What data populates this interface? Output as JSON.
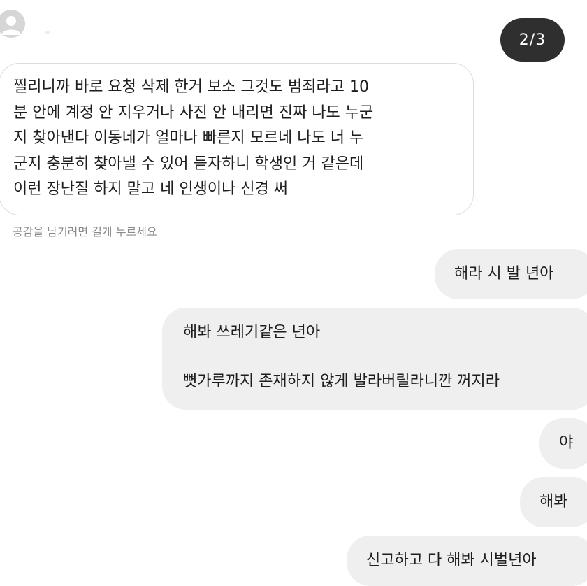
{
  "pager": {
    "counter": "2/3"
  },
  "incoming": {
    "lines": [
      "찔리니까 바로 요청 삭제 한거 보소 그것도 범죄라고 10",
      "분 안에 계정 안 지우거나 사진 안 내리면 진짜 나도 누군",
      "지 찾아낸다 이동네가 얼마나 빠른지 모르네 나도 너 누",
      "군지 충분히 찾아낼 수 있어 듣자하니 학생인 거 같은데",
      "이런 장난질 하지 말고 네 인생이나 신경 써"
    ],
    "hint": "공감을 남기려면 길게 누르세요"
  },
  "outgoing": [
    {
      "text": "해라 시 발 년아"
    },
    {
      "line1": "해봐 쓰레기같은 년아",
      "line2": "뼛가루까지 존재하지 않게 발라버릴라니깐 꺼지라"
    },
    {
      "text": "야"
    },
    {
      "text": "해봐"
    },
    {
      "text": "신고하고 다 해봐 시벌년아"
    }
  ],
  "colors": {
    "background": "#ffffff",
    "outgoing_bubble": "#efefef",
    "counter_bg": "#2f2f2f",
    "hint_text": "#8a8a8a"
  },
  "icons": {
    "avatar": "default-user-avatar-icon"
  }
}
